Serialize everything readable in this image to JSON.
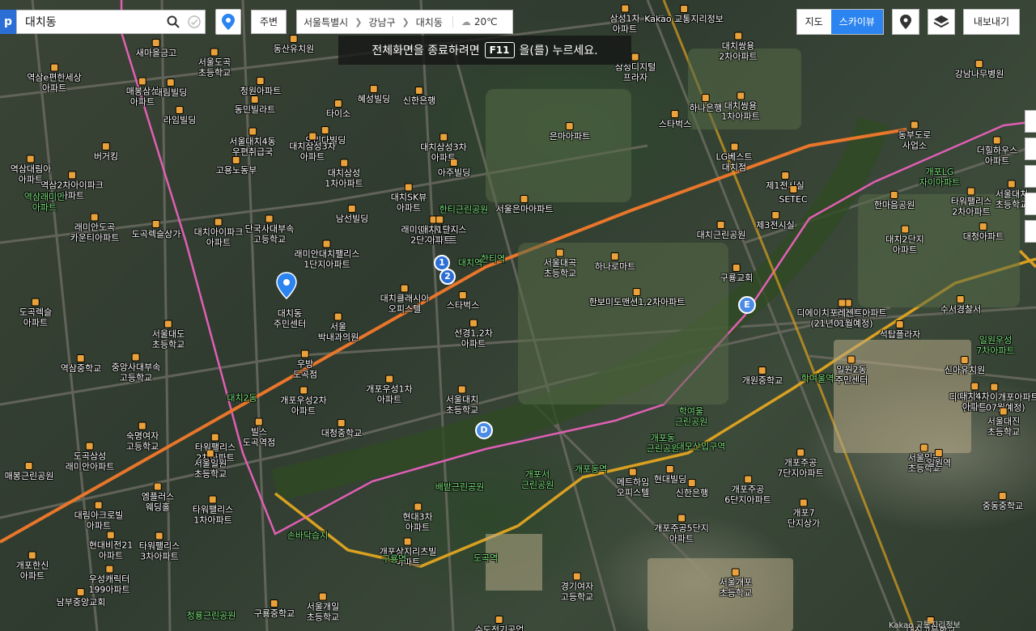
{
  "app": {
    "logo_letter": "p"
  },
  "search": {
    "query": "대치동"
  },
  "toolbar": {
    "nearby_label": "주변",
    "export_label": "내보내기"
  },
  "breadcrumb": {
    "city": "서울특별시",
    "district": "강남구",
    "dong": "대치동",
    "temperature": "20℃"
  },
  "notice": {
    "prefix": "전체화면을 종료하려면",
    "key": "F11",
    "suffix": "을(를) 누르세요."
  },
  "map_type": {
    "options": [
      "지도",
      "스카이뷰"
    ],
    "active": "스카이뷰"
  },
  "colors": {
    "accent": "#2b84f0",
    "metro_line": "#e8762b",
    "bundang_line": "#d9a021",
    "district_border": "#e05fb4"
  },
  "main_place": {
    "name": "대치동\n주민센터"
  },
  "places": [
    {
      "text": "동산유치원"
    },
    {
      "text": "서울도곡\n초등학교"
    },
    {
      "text": "청원아파트"
    },
    {
      "text": "동민빌라트"
    },
    {
      "text": "타이소"
    },
    {
      "text": "서울대치4동\n우편취급국"
    },
    {
      "text": "오리다빌딩"
    },
    {
      "text": "대치삼성3차\n아파트"
    },
    {
      "text": "대치삼성\n1차아파트"
    },
    {
      "text": "고용노동부"
    },
    {
      "text": "대치SK뷰\n아파트"
    },
    {
      "text": "한티근린공원"
    },
    {
      "text": "남선빌딩"
    },
    {
      "text": "대치아이파크\n아파트"
    },
    {
      "text": "단국사대부속\n고등학교"
    },
    {
      "text": "래미안대치팰리스\n1단지아파트"
    },
    {
      "text": "래미안대치팰리스\n2단지아파트"
    },
    {
      "text": "서울은마아파트"
    },
    {
      "text": "서울대곡\n초등학교"
    },
    {
      "text": "하나로마트"
    },
    {
      "text": "한보미도맨션1,2차아파트"
    },
    {
      "text": "선경1,2차\n아파트"
    },
    {
      "text": "대치클래시아\n오피스텔"
    },
    {
      "text": "스타벅스"
    },
    {
      "text": "서울\n박내과의원"
    },
    {
      "text": "우방\n도곡점"
    },
    {
      "text": "개포우성2차\n아파트"
    },
    {
      "text": "개포우성1차\n아파트"
    },
    {
      "text": "서울대치\n초등학교"
    },
    {
      "text": "대청중학교"
    },
    {
      "text": "빌스\n도곡역점"
    },
    {
      "text": "서울대도\n초등학교"
    },
    {
      "text": "중앙사대부속\n고등학교"
    },
    {
      "text": "도곡렉슬\n아파트"
    },
    {
      "text": "래미안도곡\n카운티아파트"
    },
    {
      "text": "도곡렉슬상가"
    },
    {
      "text": "역삼e편한세상\n아파트"
    },
    {
      "text": "숙명여자\n고등학교"
    },
    {
      "text": "타워팰리스\n2차아파트"
    },
    {
      "text": "도곡삼성\n래미안아파트"
    },
    {
      "text": "엠플러스\n웨딩홀"
    },
    {
      "text": "타워팰리스\n1차아파트"
    },
    {
      "text": "대림아크로빌\n아파트"
    },
    {
      "text": "현대비전21\n아파트"
    },
    {
      "text": "타워팰리스\n3차아파트"
    },
    {
      "text": "개포한신\n아파트"
    },
    {
      "text": "우성캐릭터\n199아파트"
    },
    {
      "text": "남부중앙교회"
    },
    {
      "text": "손바닥습지"
    },
    {
      "text": "배밭근린공원"
    },
    {
      "text": "개포서\n근린공원"
    },
    {
      "text": "현대3차\n아파트"
    },
    {
      "text": "개포상지리츠빌\n아파트"
    },
    {
      "text": "경기여자\n고등학교"
    },
    {
      "text": "수도전기공업"
    },
    {
      "text": "구룡중학교"
    },
    {
      "text": "서울개일\n초등학교"
    },
    {
      "text": "청룡근린공원"
    },
    {
      "text": "서울개포\n초등학교"
    },
    {
      "text": "현대빌딩"
    },
    {
      "text": "신한은행"
    },
    {
      "text": "메트하임\n오피스텔"
    },
    {
      "text": "개포주공\n6단지아파트"
    },
    {
      "text": "개포주공5단지\n아파트"
    },
    {
      "text": "개포7\n단지상가"
    },
    {
      "text": "개포주공\n7단지아파트"
    },
    {
      "text": "학여울\n근린공원"
    },
    {
      "text": "개포동\n근린공원"
    },
    {
      "text": "개원중학교"
    },
    {
      "text": "일원2동\n주민센터"
    },
    {
      "text": "디에이치자이개포아파트\n(21년07월예정)"
    },
    {
      "text": "대치4차\n아파트"
    },
    {
      "text": "서울일원\n초등학교"
    },
    {
      "text": "중동중학교"
    },
    {
      "text": "대치단지\n아파트"
    },
    {
      "text": "석탑플라자"
    },
    {
      "text": "구룡교회"
    },
    {
      "text": "대치근린공원"
    },
    {
      "text": "수서경찰서"
    },
    {
      "text": "일원우성\n7차아파트"
    },
    {
      "text": "신아유치원"
    },
    {
      "text": "대치2단지\n아파트"
    },
    {
      "text": "대청아파트"
    },
    {
      "text": "한마음공원"
    },
    {
      "text": "개포LG\n자이아파트"
    },
    {
      "text": "서울대치\n초등학교"
    },
    {
      "text": "동부도로\n사업소"
    },
    {
      "text": "LG베스트\n대치점"
    },
    {
      "text": "제1전시실"
    },
    {
      "text": "SETEC"
    },
    {
      "text": "제3전시실"
    },
    {
      "text": "대치쌍용\n2차아파트"
    },
    {
      "text": "대치쌍용\n1차아파트"
    },
    {
      "text": "하나은행"
    },
    {
      "text": "스타벅스"
    },
    {
      "text": "은마아파트"
    },
    {
      "text": "신한은행"
    },
    {
      "text": "대치삼성3차\n아파트"
    },
    {
      "text": "아주빌딩"
    },
    {
      "text": "혜성빌딩"
    },
    {
      "text": "버거킹"
    },
    {
      "text": "역삼2차아이파크\n아파트"
    },
    {
      "text": "역삼대림아\n아파트"
    },
    {
      "text": "역삼래미안\n아파트"
    },
    {
      "text": "역삼중학교"
    },
    {
      "text": "매봉근린공원"
    },
    {
      "text": "매봉삼성\n아파트"
    },
    {
      "text": "대림빌딩"
    },
    {
      "text": "라임빌딩"
    },
    {
      "text": "새마을금고"
    },
    {
      "text": "더힐하우스\n아파트"
    },
    {
      "text": "서울대진\n초등학교"
    },
    {
      "text": "디에이치포레센트아파트\n(21년01월예정)"
    },
    {
      "text": "대치1단지\n아파트"
    },
    {
      "text": "한티역"
    },
    {
      "text": "대치역"
    },
    {
      "text": "대치2동"
    },
    {
      "text": "도곡역"
    },
    {
      "text": "구룡역"
    },
    {
      "text": "개포동역"
    },
    {
      "text": "대모산입구역"
    },
    {
      "text": "학여울역"
    },
    {
      "text": "일원역"
    },
    {
      "text": "서울일원\n초등학교"
    },
    {
      "text": "타워팰리스\n2차아파트"
    },
    {
      "text": "대진고등학교"
    },
    {
      "text": "Kakao 교통지리정보"
    },
    {
      "text": "삼성1차\n아파트"
    },
    {
      "text": "삼성디지털\n프라자"
    },
    {
      "text": "강남나무병원"
    },
    {
      "text": "GS칼텍스"
    }
  ],
  "route_pins": [
    "1",
    "2",
    "D",
    "E"
  ],
  "credit": "Kakao 교통지리정보"
}
